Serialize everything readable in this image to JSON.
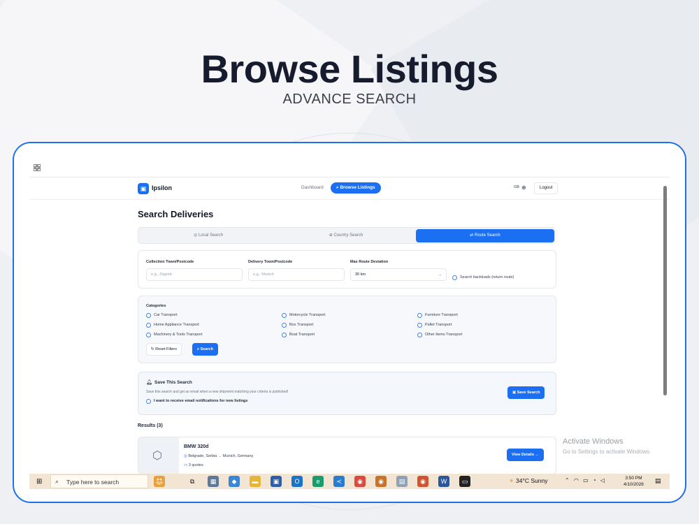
{
  "hero": {
    "title": "Browse Listings",
    "subtitle": "ADVANCE SEARCH"
  },
  "nav": {
    "logo": "Ipsilon",
    "dashboard": "Dashboard",
    "browse": "Browse Listings",
    "lang": "GB",
    "logout": "Logout"
  },
  "page": {
    "title": "Search Deliveries"
  },
  "tabs": [
    {
      "label": "Local Search",
      "icon": "pin-icon",
      "active": false
    },
    {
      "label": "Country Search",
      "icon": "globe-icon",
      "active": false
    },
    {
      "label": "Route Search",
      "icon": "route-icon",
      "active": true
    }
  ],
  "route": {
    "collection_label": "Collection Town/Postcode",
    "collection_placeholder": "e.g., Zagreb",
    "delivery_label": "Delivery Town/Postcode",
    "delivery_placeholder": "e.g., Munich",
    "deviation_label": "Max Route Deviation",
    "deviation_value": "30 km",
    "backloads_label": "Search backloads (return route)"
  },
  "categories": {
    "title": "Categories",
    "items": [
      "Car Transport",
      "Motorcycle Transport",
      "Furniture Transport",
      "Home Appliance Transport",
      "Box Transport",
      "Pallet Transport",
      "Machinery & Tools Transport",
      "Boat Transport",
      "Other Items Transport"
    ],
    "reset": "Reset Filters",
    "search": "Search"
  },
  "save": {
    "title": "Save This Search",
    "desc": "Save this search and get an email when a new shipment matching your criteria is published!",
    "checkbox": "I want to receive email notifications for new listings",
    "button": "Save Search"
  },
  "results": {
    "label": "Results (3)",
    "items": [
      {
        "title": "BMW 320d",
        "from": "Belgrade, Serbia",
        "to": "Munich, Germany",
        "quotes": "3 quotes",
        "button": "View Details"
      }
    ]
  },
  "watermark": {
    "line1": "Activate Windows",
    "line2": "Go to Settings to activate Windows."
  },
  "taskbar": {
    "search": "Type here to search",
    "weather": "34°C  Sunny",
    "time": "3:50 PM",
    "date": "4/10/2026"
  },
  "colors": {
    "accent": "#1d6ff2",
    "frame": "#1f6fe8",
    "taskbar": "#f2e5d4"
  }
}
